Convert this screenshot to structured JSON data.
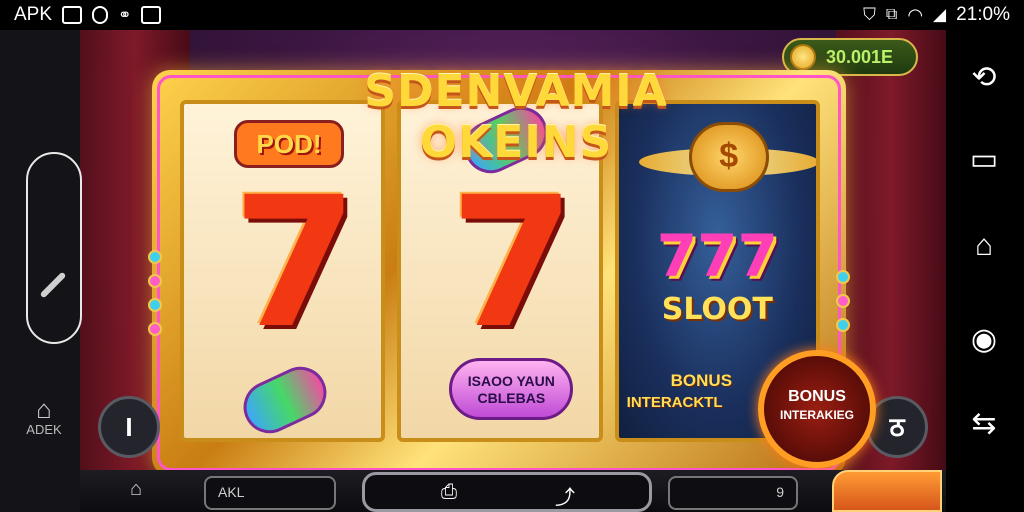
{
  "status_bar": {
    "app_label": "APK",
    "clock": "21:0%"
  },
  "left_panel": {
    "home_label": "ADEK"
  },
  "game": {
    "title": "SDENVAMIA OKEINS",
    "coins": "30.001E",
    "reel1": {
      "badge": "POD!",
      "symbol": "7"
    },
    "reel2": {
      "symbol": "7",
      "candy_label_line1": "ISAOO YAUN",
      "candy_label_line2": "CBLEBAS"
    },
    "reel3": {
      "bag_symbol": "$",
      "jackpot": "777",
      "subtitle": "SLOOT",
      "bonus_line1": "BONUS",
      "bonus_line2": "INTERACKTL"
    },
    "bonus_button": {
      "line1": "BONUS",
      "line2": "INTERAKIEG"
    },
    "left_round_button": "I",
    "right_round_button": "ठ"
  },
  "bottom_bar": {
    "field_label": "AKL",
    "right_field_value": "9"
  },
  "nav_bar": {
    "icons": [
      "rotate-icon",
      "recents-icon",
      "home-icon",
      "screenshot-icon",
      "back-icon"
    ]
  }
}
